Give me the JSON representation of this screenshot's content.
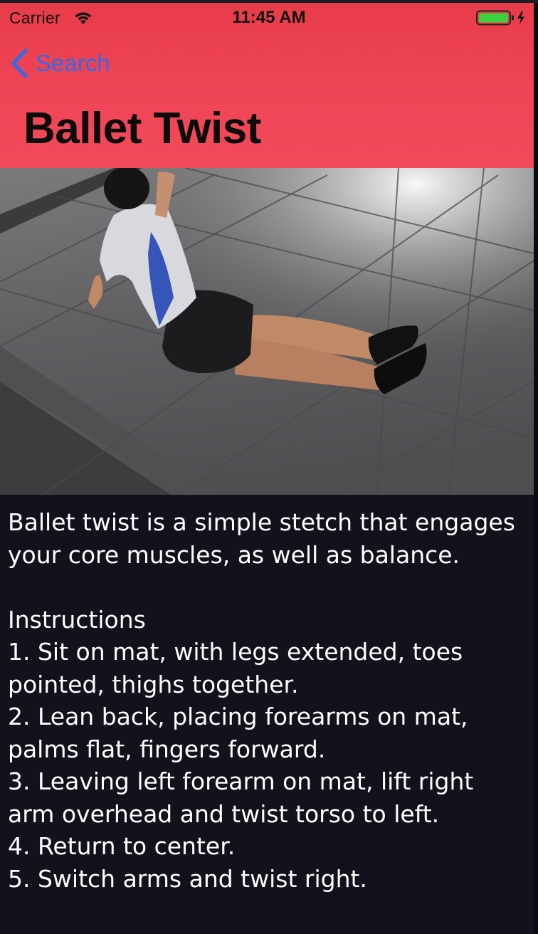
{
  "status_bar": {
    "carrier": "Carrier",
    "time": "11:45 AM",
    "wifi_icon": "wifi-icon",
    "battery_icon": "battery-charging-icon",
    "battery_color": "#3bd13e"
  },
  "nav": {
    "back_label": "Search",
    "back_icon": "chevron-left-icon",
    "title": "Ballet Twist",
    "accent_color": "#2d6cf0",
    "header_color": "#ef4556"
  },
  "photo": {
    "subject": "exercise-photo"
  },
  "description": {
    "intro_line_1": "Ballet twist is a simple stetch that engages",
    "intro_line_2": "your core muscles, as well as balance.",
    "instructions_heading": "Instructions",
    "steps": [
      "1. Sit on mat, with legs extended, toes",
      "pointed, thighs together.",
      "2. Lean back, placing forearms on mat,",
      "palms flat, fingers forward.",
      "3. Leaving left forearm on mat, lift right",
      "arm overhead and twist torso to left.",
      "4. Return to center.",
      "5. Switch arms and twist right."
    ]
  }
}
